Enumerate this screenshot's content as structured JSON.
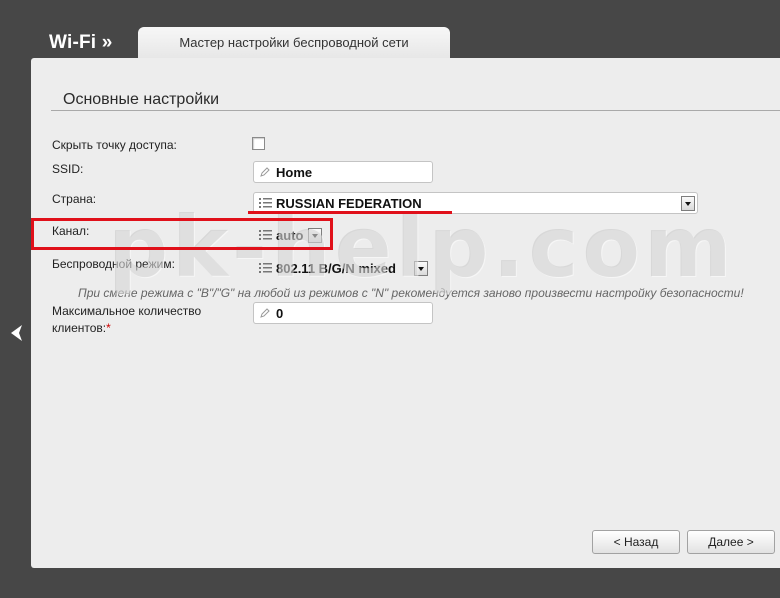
{
  "header": {
    "title": "Wi-Fi »",
    "tab_label": "Мастер настройки беспроводной сети"
  },
  "section": {
    "title": "Основные настройки"
  },
  "form": {
    "hide_ap_label": "Скрыть точку доступа:",
    "hide_ap_checked": false,
    "ssid_label": "SSID:",
    "ssid_value": "Home",
    "country_label": "Страна:",
    "country_value": "RUSSIAN FEDERATION",
    "channel_label": "Канал:",
    "channel_value": "auto",
    "mode_label": "Беспроводной режим:",
    "mode_value": "802.11 B/G/N mixed",
    "hint": "При смене режима с \"B\"/\"G\" на любой из режимов с \"N\" рекомендуется заново произвести настройку безопасности!",
    "max_clients_label_1": "Максимальное количество",
    "max_clients_label_2": "клиентов:",
    "required_mark": "*",
    "max_clients_value": "0"
  },
  "buttons": {
    "back": "< Назад",
    "next": "Далее >"
  },
  "watermark": "pk-help.com",
  "colors": {
    "background": "#474747",
    "panel": "#ededed",
    "highlight": "#e0101a"
  },
  "icons": [
    "back-arrow-icon",
    "pencil-icon",
    "list-icon",
    "chevron-down-icon"
  ]
}
